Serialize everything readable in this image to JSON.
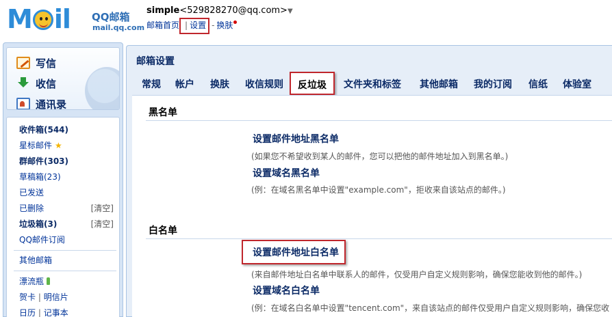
{
  "header": {
    "brand": "QQ邮箱",
    "domain": "mail.qq.com",
    "user_name": "simple",
    "user_email": "<529828270@qq.com>",
    "links": {
      "home": "邮箱首页",
      "settings": "设置",
      "skin": "换肤"
    }
  },
  "sidebar": {
    "compose": {
      "write": "写信",
      "receive": "收信",
      "contacts": "通讯录"
    },
    "folders": {
      "inbox": "收件箱(544)",
      "starred": "星标邮件",
      "group": "群邮件(303)",
      "drafts": "草稿箱(23)",
      "sent": "已发送",
      "deleted": "已删除",
      "spam": "垃圾箱(3)",
      "subscribe": "QQ邮件订阅",
      "other": "其他邮箱",
      "bottle": "漂流瓶",
      "card": "贺卡",
      "postcard": "明信片",
      "calendar": "日历",
      "notepad": "记事本",
      "clear": "[清空]",
      "pipe": "|"
    }
  },
  "main": {
    "title": "邮箱设置",
    "tabs": [
      "常规",
      "帐户",
      "换肤",
      "收信规则",
      "反垃圾",
      "文件夹和标签",
      "其他邮箱",
      "我的订阅",
      "信纸",
      "体验室"
    ],
    "blacklist": {
      "title": "黑名单",
      "addr_title": "设置邮件地址黑名单",
      "addr_desc": "(如果您不希望收到某人的邮件，您可以把他的邮件地址加入到黑名单。)",
      "domain_title": "设置域名黑名单",
      "domain_desc": "(例：在域名黑名单中设置\"example.com\"，拒收来自该站点的邮件。)"
    },
    "whitelist": {
      "title": "白名单",
      "addr_title": "设置邮件地址白名单",
      "addr_desc": "(来自邮件地址白名单中联系人的邮件，仅受用户自定义规则影响，确保您能收到他的邮件。)",
      "domain_title": "设置域名白名单",
      "domain_desc": "(例：在域名白名单中设置\"tencent.com\"，来自该站点的邮件仅受用户自定义规则影响，确保您收"
    }
  }
}
